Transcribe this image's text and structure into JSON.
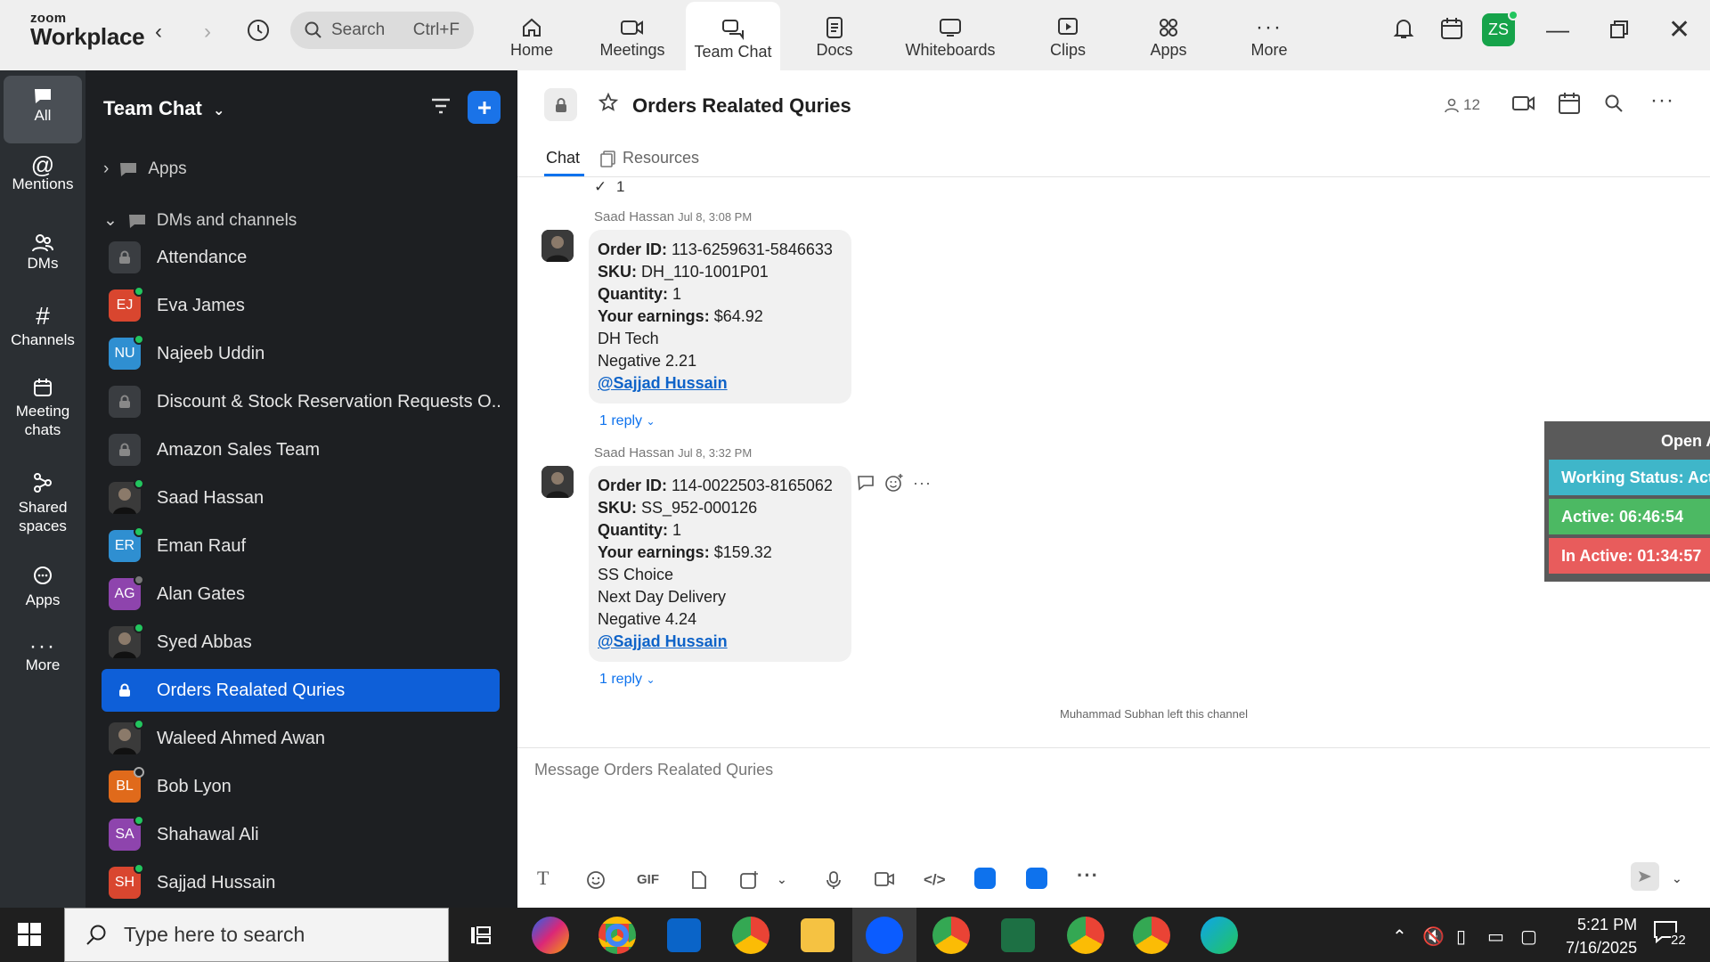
{
  "topbar": {
    "logo_top": "zoom",
    "logo_bottom": "Workplace",
    "search_placeholder": "Search",
    "search_shortcut": "Ctrl+F",
    "tabs": [
      {
        "label": "Home",
        "icon": "home-icon"
      },
      {
        "label": "Meetings",
        "icon": "video-icon"
      },
      {
        "label": "Team Chat",
        "icon": "chat-icon",
        "active": true
      },
      {
        "label": "Docs",
        "icon": "doc-icon"
      },
      {
        "label": "Whiteboards",
        "icon": "whiteboard-icon"
      },
      {
        "label": "Clips",
        "icon": "clips-icon"
      },
      {
        "label": "Apps",
        "icon": "apps-icon"
      },
      {
        "label": "More",
        "icon": "more-icon"
      }
    ],
    "user_initials": "ZS"
  },
  "rail": {
    "items": [
      {
        "label": "All",
        "active": true
      },
      {
        "label": "Mentions"
      },
      {
        "label": "DMs"
      },
      {
        "label": "Channels"
      },
      {
        "label": "Meeting chats"
      },
      {
        "label": "Shared spaces"
      },
      {
        "label": "Apps"
      },
      {
        "label": "More"
      }
    ]
  },
  "channel_list": {
    "title": "Team Chat",
    "sections": {
      "apps": "Apps",
      "dms": "DMs and channels"
    },
    "rows": [
      {
        "name": "Attendance",
        "type": "lock"
      },
      {
        "name": "Eva James",
        "initials": "EJ",
        "color": "#d9462f",
        "status": "online"
      },
      {
        "name": "Najeeb Uddin",
        "initials": "NU",
        "color": "#2f8fd1",
        "status": "online"
      },
      {
        "name": "Discount & Stock Reservation Requests O...",
        "type": "lock"
      },
      {
        "name": "Amazon Sales Team",
        "type": "lock"
      },
      {
        "name": "Saad Hassan",
        "type": "photo",
        "status": "online"
      },
      {
        "name": "Eman Rauf",
        "initials": "ER",
        "color": "#2f8fd1",
        "status": "online"
      },
      {
        "name": "Alan Gates",
        "initials": "AG",
        "color": "#8e44ad",
        "status": "away"
      },
      {
        "name": "Syed Abbas",
        "type": "photo",
        "status": "online"
      },
      {
        "name": "Orders Realated Quries",
        "type": "lock",
        "selected": true
      },
      {
        "name": "Waleed Ahmed Awan",
        "type": "photo",
        "status": "online"
      },
      {
        "name": "Bob Lyon",
        "initials": "BL",
        "color": "#e06a1b",
        "status": "offline"
      },
      {
        "name": "Shahawal Ali",
        "initials": "SA",
        "color": "#8e44ad",
        "status": "online"
      },
      {
        "name": "Sajjad Hussain",
        "initials": "SH",
        "color": "#d9462f",
        "status": "online"
      }
    ]
  },
  "chat": {
    "title": "Orders Realated Quries",
    "member_count": "12",
    "tabs": [
      "Chat",
      "Resources"
    ],
    "prev_check": "1",
    "messages": [
      {
        "sender": "Saad Hassan",
        "time": "Jul 8, 3:08 PM",
        "order_label": "Order ID:",
        "order_id": "113-6259631-5846633",
        "sku_label": "SKU:",
        "sku": "DH_110-1001P01",
        "qty_label": "Quantity:",
        "qty": "1",
        "earn_label": "Your earnings:",
        "earnings": "$64.92",
        "line1": "DH Tech",
        "line2": "Negative 2.21",
        "mention": "@Sajjad Hussain",
        "replies": "1 reply"
      },
      {
        "sender": "Saad Hassan",
        "time": "Jul 8, 3:32 PM",
        "order_label": "Order ID:",
        "order_id": "114-0022503-8165062",
        "sku_label": "SKU:",
        "sku": "SS_952-000126",
        "qty_label": "Quantity:",
        "qty": "1",
        "earn_label": "Your earnings:",
        "earnings": "$159.32",
        "line1": "SS Choice",
        "line2": "Next Day Delivery",
        "line3": "Negative 4.24",
        "mention": "@Sajjad Hussain",
        "replies": "1 reply"
      }
    ],
    "system_message": "Muhammad Subhan left this channel",
    "composer_placeholder": "Message Orders Realated Quries",
    "gif_label": "GIF"
  },
  "widget": {
    "open_label": "Open A",
    "working_status": "Working Status: Act",
    "active": "Active: 06:46:54",
    "inactive": "In Active: 01:34:57",
    "colors": {
      "working": "#3fb6c9",
      "active": "#4cb963",
      "inactive": "#e85c5c"
    }
  },
  "taskbar": {
    "search_placeholder": "Type here to search",
    "time": "5:21 PM",
    "date": "7/16/2025",
    "notification_count": "22"
  }
}
